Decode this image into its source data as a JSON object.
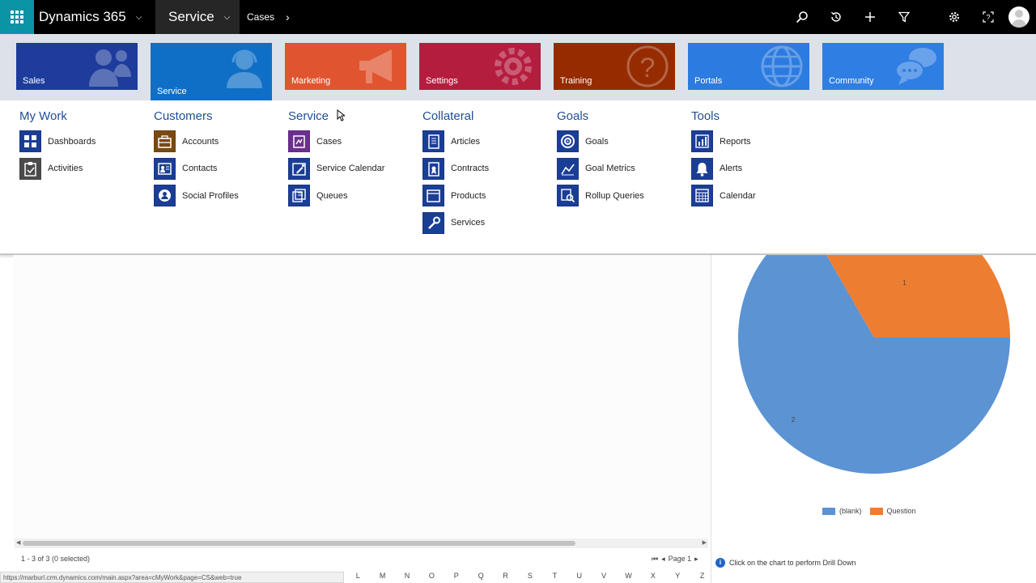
{
  "topbar": {
    "brand": "Dynamics 365",
    "module": "Service",
    "breadcrumb": "Cases",
    "icons": [
      "search-icon",
      "recent-icon",
      "plus-icon",
      "filter-icon",
      "gear-icon",
      "help-icon",
      "user-icon"
    ],
    "waffle_color": "#0b93a6"
  },
  "tiles": [
    {
      "label": "Sales",
      "color": "#1d3c9c",
      "icon": "people-icon"
    },
    {
      "label": "Service",
      "color": "#0f6fc6",
      "icon": "agent-icon"
    },
    {
      "label": "Marketing",
      "color": "#e0552f",
      "icon": "megaphone-icon"
    },
    {
      "label": "Settings",
      "color": "#b51d3f",
      "icon": "gear-icon"
    },
    {
      "label": "Training",
      "color": "#962b00",
      "icon": "question-icon"
    },
    {
      "label": "Portals",
      "color": "#2c7be0",
      "icon": "globe-icon"
    },
    {
      "label": "Community",
      "color": "#2f7ee3",
      "icon": "chat-icon"
    }
  ],
  "menu": {
    "columns": [
      {
        "title": "My Work",
        "items": [
          {
            "label": "Dashboards",
            "icon": "dashboard-icon",
            "color": "#1b3e95"
          },
          {
            "label": "Activities",
            "icon": "activities-icon",
            "color": "#4b4b4b"
          }
        ]
      },
      {
        "title": "Customers",
        "items": [
          {
            "label": "Accounts",
            "icon": "accounts-icon",
            "color": "#7a4a12"
          },
          {
            "label": "Contacts",
            "icon": "contacts-icon",
            "color": "#1b3e95"
          },
          {
            "label": "Social Profiles",
            "icon": "social-profiles-icon",
            "color": "#1b3e95"
          }
        ]
      },
      {
        "title": "Service",
        "items": [
          {
            "label": "Cases",
            "icon": "cases-icon",
            "color": "#6b2f8f"
          },
          {
            "label": "Service Calendar",
            "icon": "service-calendar-icon",
            "color": "#1b3e95"
          },
          {
            "label": "Queues",
            "icon": "queues-icon",
            "color": "#1b3e95"
          }
        ]
      },
      {
        "title": "Collateral",
        "items": [
          {
            "label": "Articles",
            "icon": "articles-icon",
            "color": "#1b3e95"
          },
          {
            "label": "Contracts",
            "icon": "contracts-icon",
            "color": "#1b3e95"
          },
          {
            "label": "Products",
            "icon": "products-icon",
            "color": "#1b3e95"
          },
          {
            "label": "Services",
            "icon": "services-icon",
            "color": "#1b3e95"
          }
        ]
      },
      {
        "title": "Goals",
        "items": [
          {
            "label": "Goals",
            "icon": "goals-icon",
            "color": "#1b3e95"
          },
          {
            "label": "Goal Metrics",
            "icon": "goal-metrics-icon",
            "color": "#1b3e95"
          },
          {
            "label": "Rollup Queries",
            "icon": "rollup-queries-icon",
            "color": "#1b3e95"
          }
        ]
      },
      {
        "title": "Tools",
        "items": [
          {
            "label": "Reports",
            "icon": "reports-icon",
            "color": "#1b3e95"
          },
          {
            "label": "Alerts",
            "icon": "alerts-icon",
            "color": "#1b3e95"
          },
          {
            "label": "Calendar",
            "icon": "calendar-icon",
            "color": "#1b3e95"
          }
        ]
      }
    ]
  },
  "grid": {
    "record_count": "1 - 3 of 3 (0 selected)",
    "page_label": "Page 1",
    "letters": [
      "L",
      "M",
      "N",
      "O",
      "P",
      "Q",
      "R",
      "S",
      "T",
      "U",
      "V",
      "W",
      "X",
      "Y",
      "Z"
    ],
    "status_url": "https://marburl.crm.dynamics.com/main.aspx?area=cMyWork&page=CS&web=true"
  },
  "chart_data": {
    "type": "pie",
    "categories": [
      "(blank)",
      "Question"
    ],
    "values": [
      2,
      1
    ],
    "data_labels": [
      "2",
      "1"
    ],
    "colors": [
      "#5b93d3",
      "#ed7d31"
    ],
    "legend_position": "bottom"
  },
  "chart_footer": {
    "hint": "Click on the chart to perform Drill Down"
  }
}
